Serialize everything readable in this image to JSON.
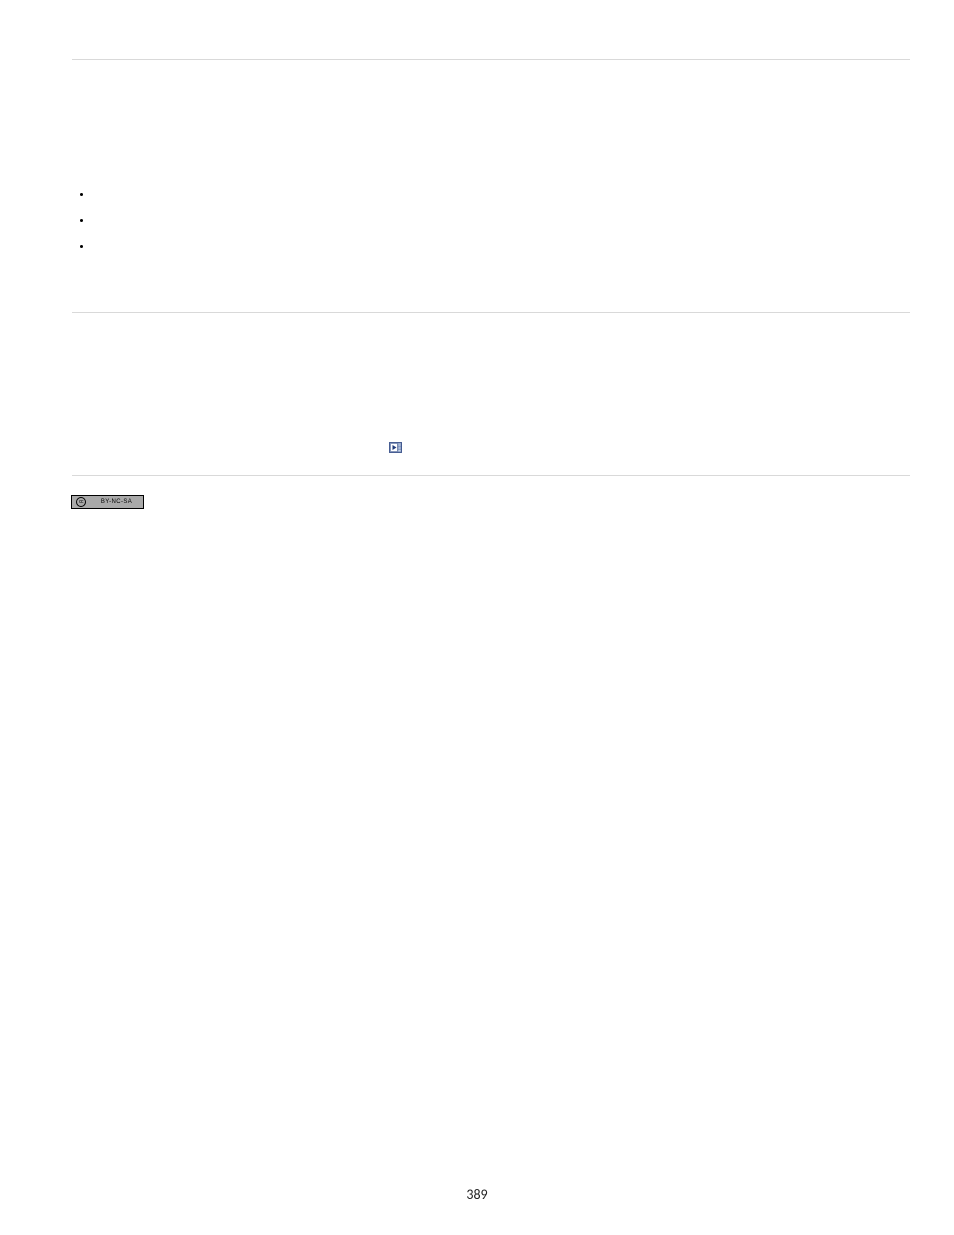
{
  "page_number": "389",
  "cc_badge_text": "BY-NC-SA"
}
